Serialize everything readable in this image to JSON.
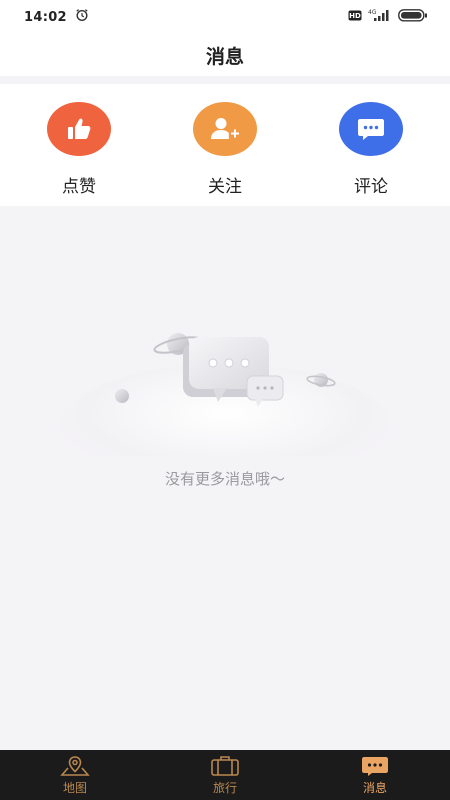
{
  "status_bar": {
    "time": "14:02",
    "icons": [
      "alarm-icon",
      "hd-icon",
      "4g-signal-icon",
      "battery-icon"
    ]
  },
  "header": {
    "title": "消息"
  },
  "categories": [
    {
      "label": "点赞",
      "icon": "thumbs-up-icon",
      "color": "#f0633f"
    },
    {
      "label": "关注",
      "icon": "add-user-icon",
      "color": "#f09a45"
    },
    {
      "label": "评论",
      "icon": "comment-icon",
      "color": "#3f6fe8"
    }
  ],
  "empty_state": {
    "text": "没有更多消息哦～"
  },
  "tabbar": {
    "items": [
      {
        "label": "地图",
        "icon": "map-pin-icon"
      },
      {
        "label": "旅行",
        "icon": "suitcase-icon"
      },
      {
        "label": "消息",
        "icon": "message-icon",
        "active": true
      }
    ]
  },
  "colors": {
    "accent": "#eaa463",
    "tabbar_bg": "#1b1b1c",
    "page_bg": "#f4f3f6"
  }
}
